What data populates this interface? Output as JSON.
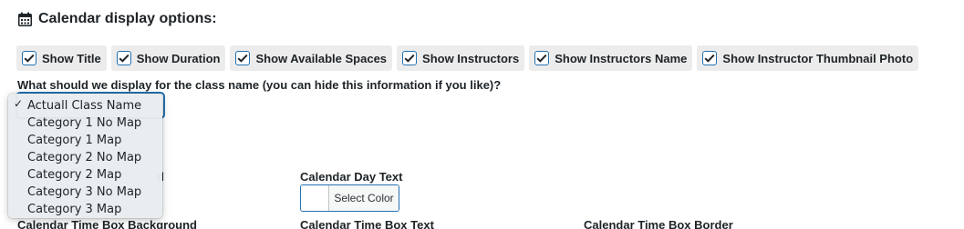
{
  "heading": {
    "icon": "calendar-icon",
    "title": "Calendar display options:"
  },
  "options": [
    {
      "label": "Show Title",
      "checked": true
    },
    {
      "label": "Show Duration",
      "checked": true
    },
    {
      "label": "Show Available Spaces",
      "checked": true
    },
    {
      "label": "Show Instructors",
      "checked": true
    },
    {
      "label": "Show Instructors Name",
      "checked": true
    },
    {
      "label": "Show Instructor Thumbnail Photo",
      "checked": true
    }
  ],
  "class_name_question": "What should we display for the class name (you can hide this information if you like)?",
  "class_name_select": {
    "selected": "Actuall Class Name",
    "options": [
      "Actuall Class Name",
      "Category 1 No Map",
      "Category 1 Map",
      "Category 2 No Map",
      "Category 2 Map",
      "Category 3 No Map",
      "Category 3 Map"
    ]
  },
  "color_fields": {
    "partial_label": "d",
    "day_text_label": "Calendar Day Text",
    "select_color_label": "Select Color",
    "time_box_background_label": "Calendar Time Box Background",
    "time_box_text_label": "Calendar Time Box Text",
    "time_box_border_label": "Calendar Time Box Border"
  },
  "colors": {
    "accent": "#2271b1",
    "option_bg": "#ececec",
    "text": "#1d2327"
  }
}
